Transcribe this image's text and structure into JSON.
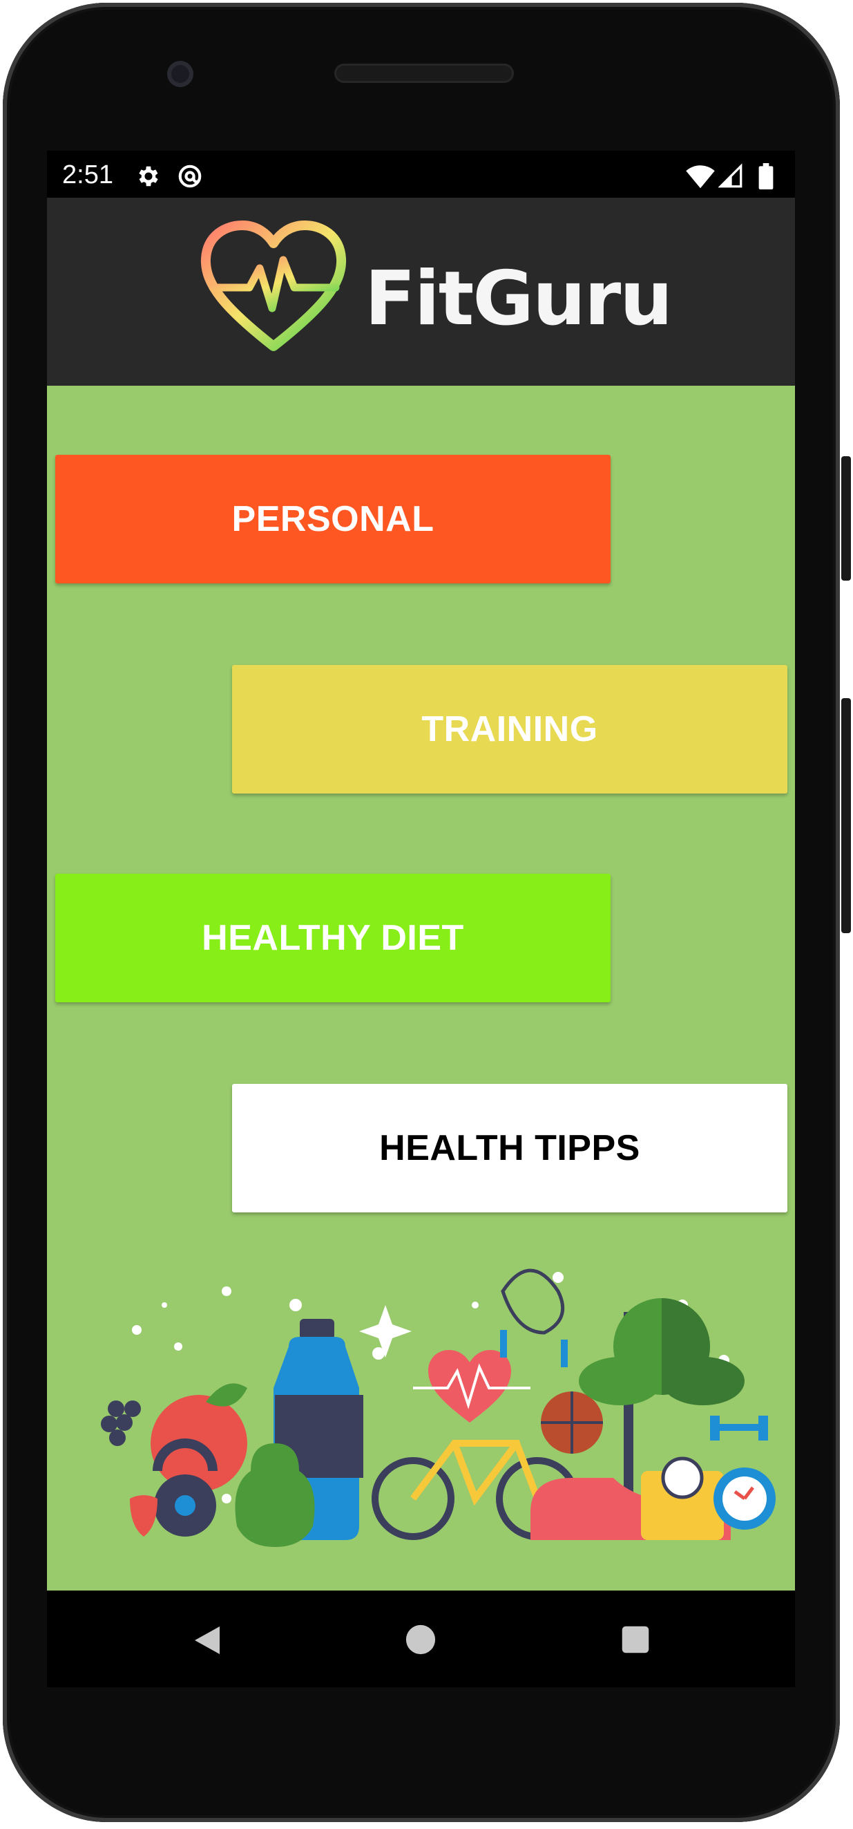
{
  "status_bar": {
    "time": "2:51",
    "icons": [
      "gear-icon",
      "at-sign-icon",
      "wifi-icon",
      "signal-icon",
      "battery-icon"
    ]
  },
  "app": {
    "title": "FitGuru",
    "logo_icon": "heart-pulse-icon"
  },
  "menu": {
    "personal": {
      "label": "PERSONAL",
      "color": "#FF5722",
      "text_color": "#FFFFFF"
    },
    "training": {
      "label": "TRAINING",
      "color": "#E8D952",
      "text_color": "#FFFFFF"
    },
    "healthy_diet": {
      "label": "HEALTHY DIET",
      "color": "#88EE18",
      "text_color": "#FFFFFF"
    },
    "health_tipps": {
      "label": "HEALTH TIPPS",
      "color": "#FFFFFF",
      "text_color": "#000000"
    }
  },
  "background_color": "#99CA6C",
  "header_color": "#292929",
  "nav": {
    "icons": [
      "back-icon",
      "home-icon",
      "recents-icon"
    ]
  }
}
